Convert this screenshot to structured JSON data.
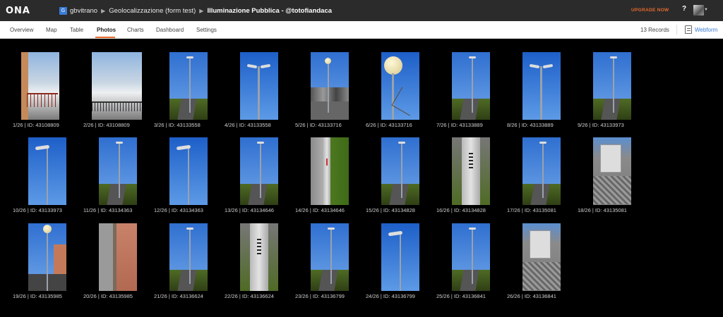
{
  "brand": {
    "logo": "ONA"
  },
  "breadcrumb": {
    "org_badge": "G",
    "user": "gbvitrano",
    "project": "Geolocalizzazione (form test)",
    "form": "Illuminazione Pubblica - @totofiandaca"
  },
  "header": {
    "upgrade": "UPGRADE NOW",
    "help": "?"
  },
  "tabs": [
    "Overview",
    "Map",
    "Table",
    "Photos",
    "Charts",
    "Dashboard",
    "Settings"
  ],
  "active_tab": "Photos",
  "records": "13 Records",
  "webform": "Webform",
  "photos": [
    {
      "caption": "1/26 | ID: 43108809",
      "scene": "snow-balcony"
    },
    {
      "caption": "2/26 | ID: 43108809",
      "scene": "snow-valley"
    },
    {
      "caption": "3/26 | ID: 43133558",
      "scene": "street-pole"
    },
    {
      "caption": "4/26 | ID: 43133558",
      "scene": "double-lamp"
    },
    {
      "caption": "5/26 | ID: 43133716",
      "scene": "parking-lamp"
    },
    {
      "caption": "6/26 | ID: 43133716",
      "scene": "globe-lamp"
    },
    {
      "caption": "7/26 | ID: 43133889",
      "scene": "street-pole"
    },
    {
      "caption": "8/26 | ID: 43133889",
      "scene": "double-lamp"
    },
    {
      "caption": "9/26 | ID: 43133973",
      "scene": "street-pole"
    },
    {
      "caption": "10/26 | ID: 43133973",
      "scene": "single-lamp"
    },
    {
      "caption": "11/26 | ID: 43134363",
      "scene": "street-pole"
    },
    {
      "caption": "12/26 | ID: 43134363",
      "scene": "single-lamp"
    },
    {
      "caption": "13/26 | ID: 43134646",
      "scene": "street-pole"
    },
    {
      "caption": "14/26 | ID: 43134646",
      "scene": "pole-base"
    },
    {
      "caption": "15/26 | ID: 43134828",
      "scene": "street-pole"
    },
    {
      "caption": "16/26 | ID: 43134828",
      "scene": "pole-label"
    },
    {
      "caption": "17/26 | ID: 43135081",
      "scene": "street-pole"
    },
    {
      "caption": "18/26 | ID: 43135081",
      "scene": "utility-box"
    },
    {
      "caption": "19/26 | ID: 43135985",
      "scene": "globe-street"
    },
    {
      "caption": "20/26 | ID: 43135985",
      "scene": "sidewalk-pole"
    },
    {
      "caption": "21/26 | ID: 43136624",
      "scene": "street-pole"
    },
    {
      "caption": "22/26 | ID: 43136624",
      "scene": "pole-label"
    },
    {
      "caption": "23/26 | ID: 43136799",
      "scene": "street-pole"
    },
    {
      "caption": "24/26 | ID: 43136799",
      "scene": "single-lamp"
    },
    {
      "caption": "25/26 | ID: 43136841",
      "scene": "street-pole"
    },
    {
      "caption": "26/26 | ID: 43136841",
      "scene": "utility-box"
    }
  ]
}
